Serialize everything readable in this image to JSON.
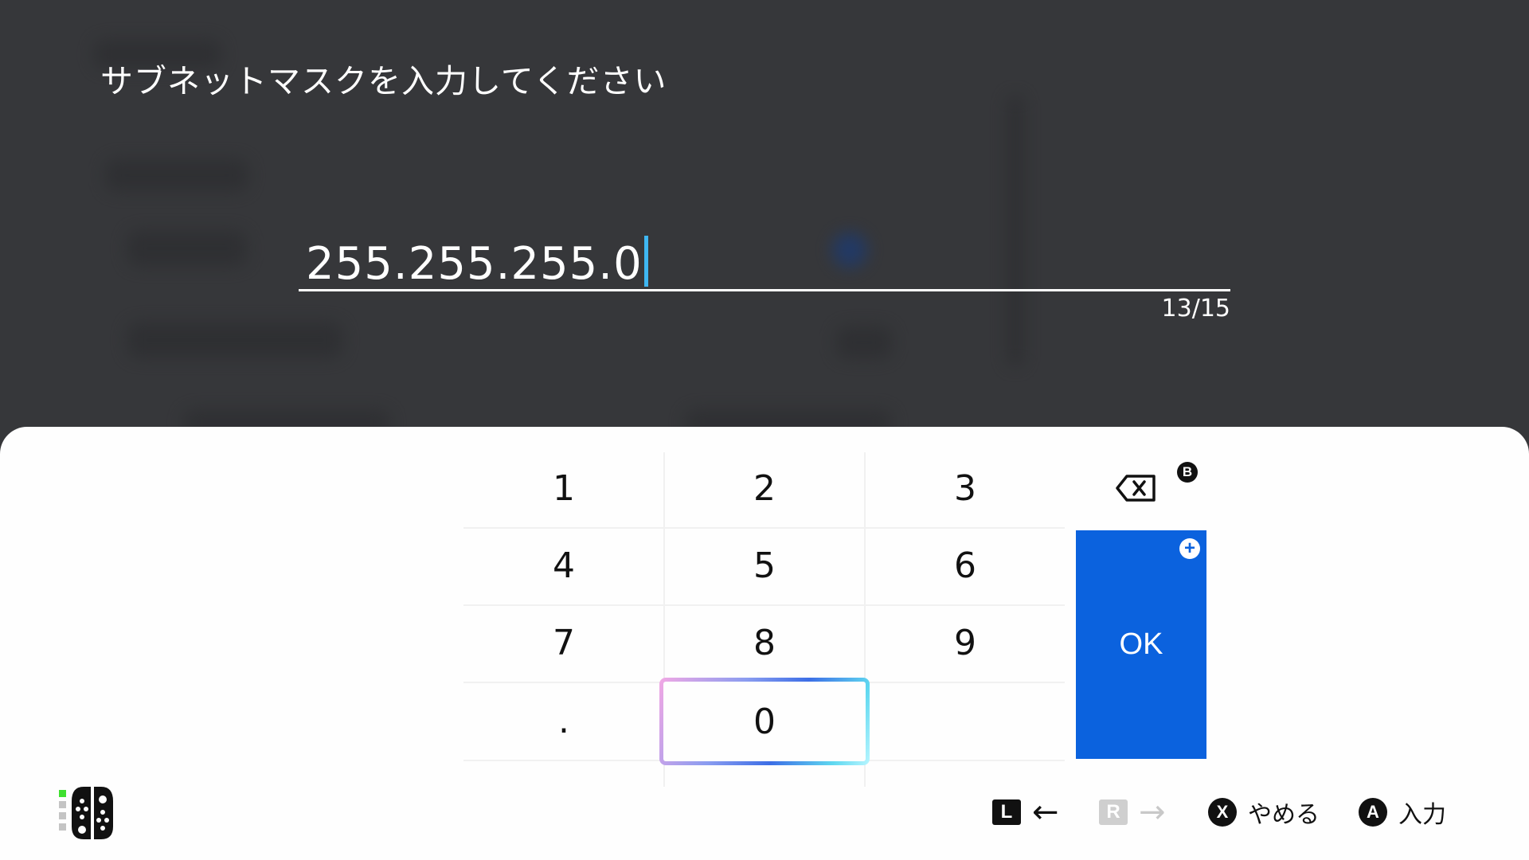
{
  "colors": {
    "backdrop": "#36373a",
    "keyboard_background": "#fefefe",
    "ok_button": "#0b62de",
    "caret": "#3fb7f2",
    "player_led": "#3fe030"
  },
  "prompt": {
    "title": "サブネットマスクを入力してください"
  },
  "entry": {
    "value": "255.255.255.0",
    "counter": "13/15"
  },
  "keypad": {
    "rows": [
      [
        "1",
        "2",
        "3"
      ],
      [
        "4",
        "5",
        "6"
      ],
      [
        "7",
        "8",
        "9"
      ],
      [
        ".",
        "0",
        ""
      ]
    ],
    "selected_key": "0",
    "backspace_icon": "backspace-icon",
    "backspace_button_badge": "B",
    "ok_label": "OK",
    "ok_button_badge": "+"
  },
  "footer": {
    "controller_icon": "joycon-pair-icon",
    "hints": [
      {
        "badge": "L",
        "arrow": "←",
        "enabled": true
      },
      {
        "badge": "R",
        "arrow": "→",
        "enabled": false
      },
      {
        "badge": "X",
        "label": "やめる"
      },
      {
        "badge": "A",
        "label": "入力"
      }
    ]
  }
}
